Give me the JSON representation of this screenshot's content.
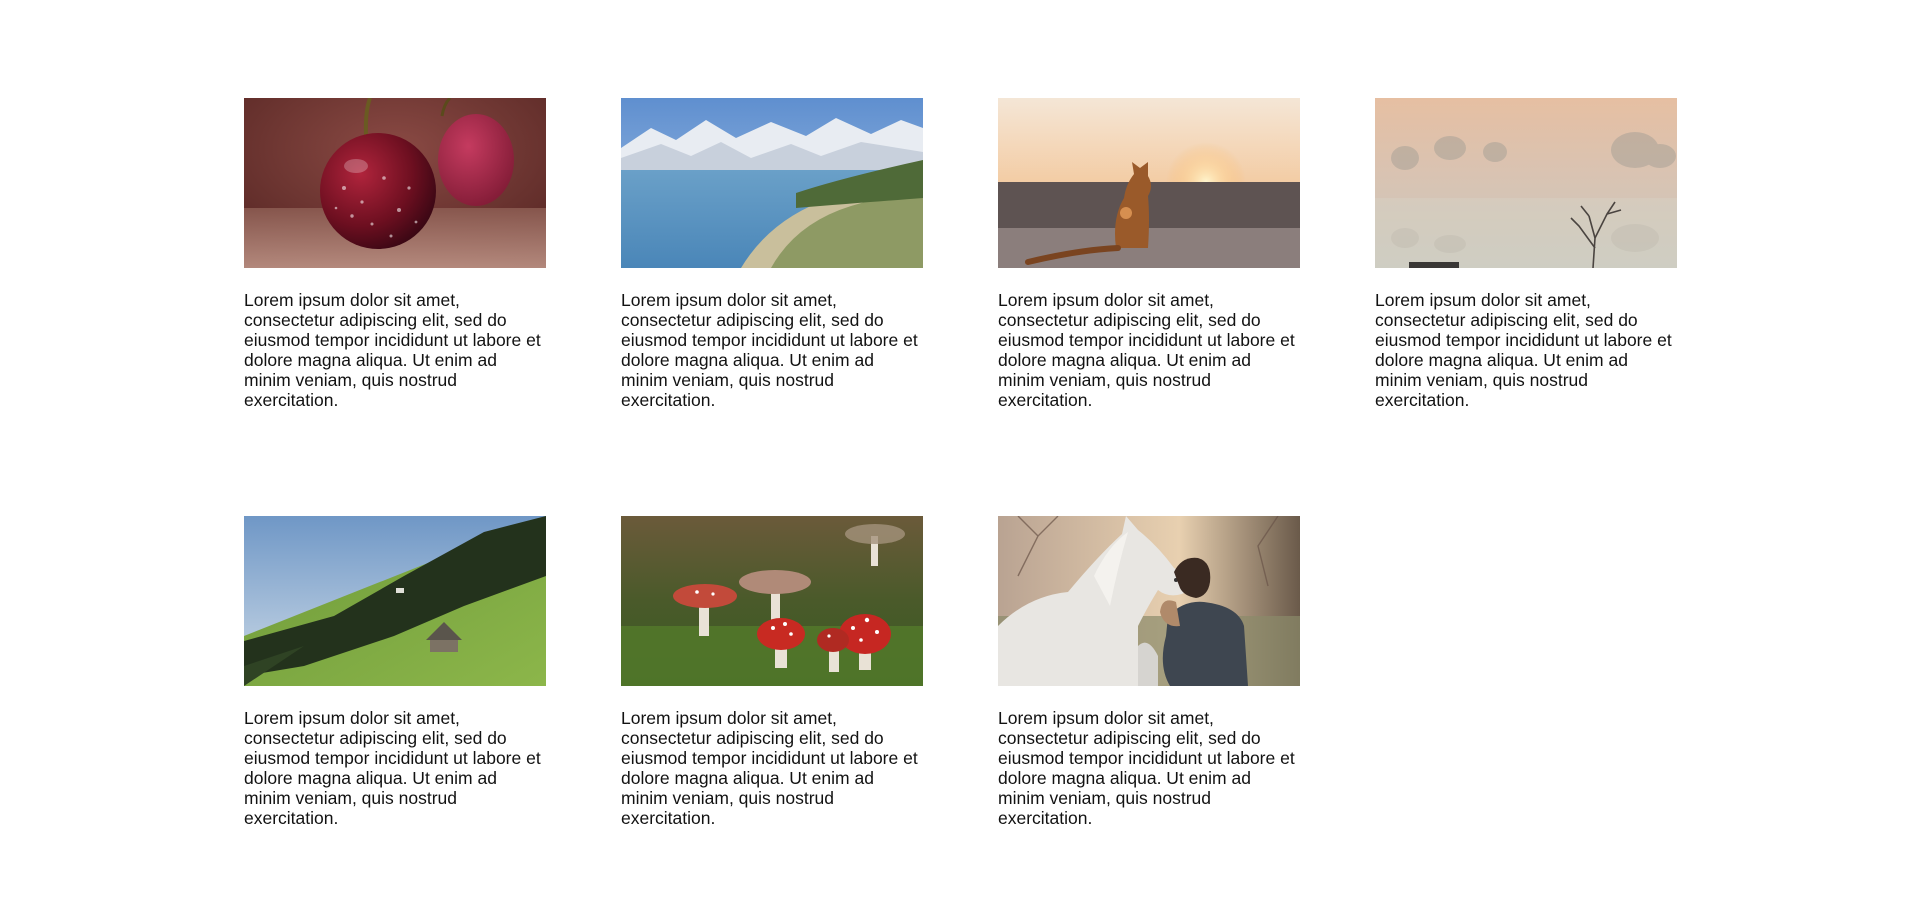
{
  "cards": [
    {
      "image": "cherries-photo",
      "text": "Lorem ipsum dolor sit amet, consectetur adipiscing elit, sed do eiusmod tempor incididunt ut labore et dolore magna aliqua. Ut enim ad minim veniam, quis nostrud exercitation."
    },
    {
      "image": "mountain-lake-photo",
      "text": "Lorem ipsum dolor sit amet, consectetur adipiscing elit, sed do eiusmod tempor incididunt ut labore et dolore magna aliqua. Ut enim ad minim veniam, quis nostrud exercitation."
    },
    {
      "image": "cat-sunset-photo",
      "text": "Lorem ipsum dolor sit amet, consectetur adipiscing elit, sed do eiusmod tempor incididunt ut labore et dolore magna aliqua. Ut enim ad minim veniam, quis nostrud exercitation."
    },
    {
      "image": "foggy-trees-photo",
      "text": "Lorem ipsum dolor sit amet, consectetur adipiscing elit, sed do eiusmod tempor incididunt ut labore et dolore magna aliqua. Ut enim ad minim veniam, quis nostrud exercitation."
    },
    {
      "image": "hillside-hut-photo",
      "text": "Lorem ipsum dolor sit amet, consectetur adipiscing elit, sed do eiusmod tempor incididunt ut labore et dolore magna aliqua. Ut enim ad minim veniam, quis nostrud exercitation."
    },
    {
      "image": "mushrooms-photo",
      "text": "Lorem ipsum dolor sit amet, consectetur adipiscing elit, sed do eiusmod tempor incididunt ut labore et dolore magna aliqua. Ut enim ad minim veniam, quis nostrud exercitation."
    },
    {
      "image": "man-and-horse-photo",
      "text": "Lorem ipsum dolor sit amet, consectetur adipiscing elit, sed do eiusmod tempor incididunt ut labore et dolore magna aliqua. Ut enim ad minim veniam, quis nostrud exercitation."
    }
  ]
}
